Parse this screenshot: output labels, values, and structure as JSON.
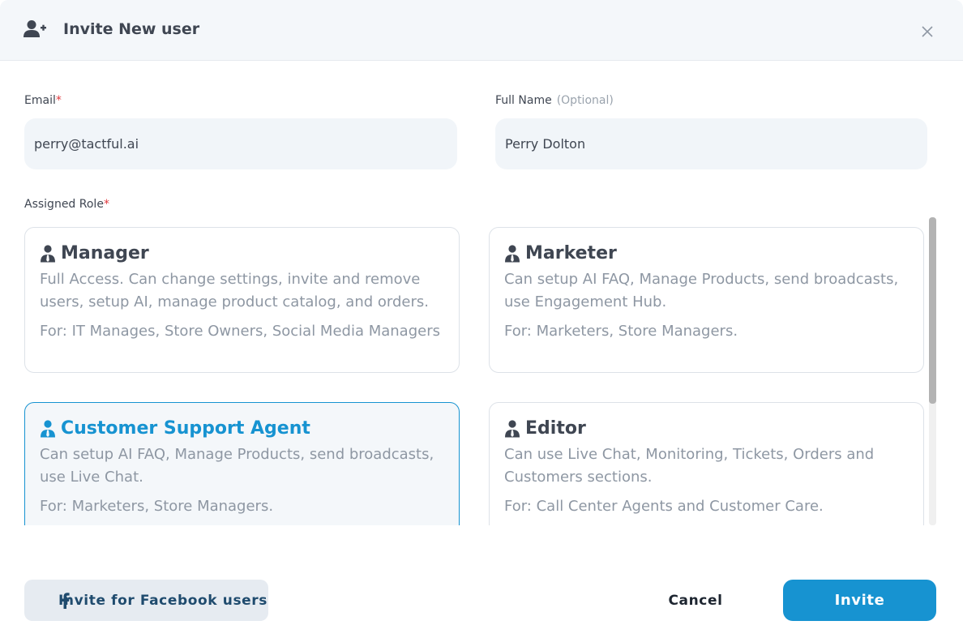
{
  "header": {
    "title": "Invite New user",
    "icon": "user-plus-icon"
  },
  "form": {
    "email": {
      "label": "Email",
      "required_mark": "*",
      "value": "perry@tactful.ai"
    },
    "full_name": {
      "label": "Full Name",
      "optional_text": "(Optional)",
      "value": "Perry Dolton"
    },
    "assigned_role": {
      "label": "Assigned Role",
      "required_mark": "*"
    }
  },
  "roles": [
    {
      "title": "Manager",
      "description": "Full Access. Can change settings, invite and remove users, setup AI, manage product catalog, and orders.",
      "for_text": "For: IT Manages, Store Owners, Social Media Managers",
      "selected": false
    },
    {
      "title": "Marketer",
      "description": "Can setup AI FAQ, Manage Products, send broadcasts, use Engagement Hub.",
      "for_text": "For: Marketers, Store Managers.",
      "selected": false
    },
    {
      "title": "Customer Support Agent",
      "description": "Can setup AI FAQ, Manage Products, send broadcasts, use Live Chat.",
      "for_text": "For: Marketers, Store Managers.",
      "selected": true
    },
    {
      "title": "Editor",
      "description": "Can use Live Chat, Monitoring, Tickets, Orders and Customers sections.",
      "for_text": "For: Call Center Agents and Customer Care.",
      "selected": false
    }
  ],
  "footer": {
    "facebook_label": "Invite for Facebook users",
    "cancel_label": "Cancel",
    "invite_label": "Invite"
  },
  "colors": {
    "accent": "#1793d1",
    "required": "#e0393e",
    "header_bg": "#f4f7fa",
    "input_bg": "#f1f5f9",
    "muted_text": "#8e97a3"
  }
}
